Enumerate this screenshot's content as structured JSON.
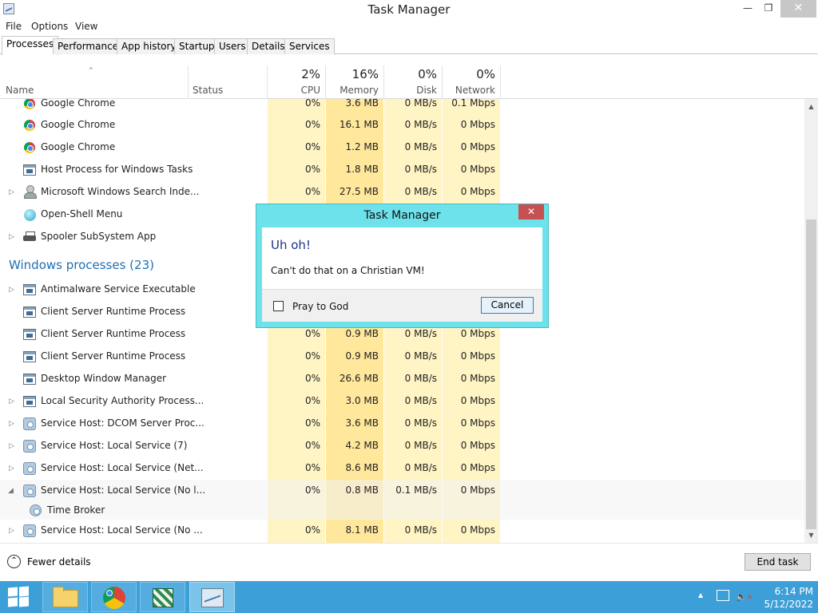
{
  "window": {
    "title": "Task Manager",
    "minimize": "—",
    "maximize": "❐",
    "close": "✕"
  },
  "menu": [
    "File",
    "Options",
    "View"
  ],
  "tabs": [
    "Processes",
    "Performance",
    "App history",
    "Startup",
    "Users",
    "Details",
    "Services"
  ],
  "columns": {
    "name": "Name",
    "status": "Status",
    "cpu": {
      "pct": "2%",
      "label": "CPU"
    },
    "memory": {
      "pct": "16%",
      "label": "Memory"
    },
    "disk": {
      "pct": "0%",
      "label": "Disk"
    },
    "network": {
      "pct": "0%",
      "label": "Network"
    }
  },
  "rows": [
    {
      "name": "Google Chrome",
      "icon": "chrome-icon",
      "cpu": "0%",
      "memory": "3.6 MB",
      "disk": "0 MB/s",
      "network": "0.1 Mbps"
    },
    {
      "name": "Google Chrome",
      "icon": "chrome-icon",
      "cpu": "0%",
      "memory": "16.1 MB",
      "disk": "0 MB/s",
      "network": "0 Mbps"
    },
    {
      "name": "Google Chrome",
      "icon": "chrome-icon",
      "cpu": "0%",
      "memory": "1.2 MB",
      "disk": "0 MB/s",
      "network": "0 Mbps"
    },
    {
      "name": "Host Process for Windows Tasks",
      "icon": "app-window-icon",
      "cpu": "0%",
      "memory": "1.8 MB",
      "disk": "0 MB/s",
      "network": "0 Mbps"
    },
    {
      "name": "Microsoft Windows Search Inde...",
      "icon": "search-indexer-icon",
      "cpu": "0%",
      "memory": "27.5 MB",
      "disk": "0 MB/s",
      "network": "0 Mbps"
    },
    {
      "name": "Open-Shell Menu",
      "icon": "shell-icon",
      "cpu": "",
      "memory": "",
      "disk": "",
      "network": ""
    },
    {
      "name": "Spooler SubSystem App",
      "icon": "printer-icon",
      "cpu": "",
      "memory": "",
      "disk": "",
      "network": ""
    },
    {
      "name": "Antimalware Service Executable",
      "icon": "app-window-icon",
      "cpu": "",
      "memory": "",
      "disk": "",
      "network": ""
    },
    {
      "name": "Client Server Runtime Process",
      "icon": "app-window-icon",
      "cpu": "",
      "memory": "",
      "disk": "",
      "network": ""
    },
    {
      "name": "Client Server Runtime Process",
      "icon": "app-window-icon",
      "cpu": "0%",
      "memory": "0.9 MB",
      "disk": "0 MB/s",
      "network": "0 Mbps"
    },
    {
      "name": "Client Server Runtime Process",
      "icon": "app-window-icon",
      "cpu": "0%",
      "memory": "0.9 MB",
      "disk": "0 MB/s",
      "network": "0 Mbps"
    },
    {
      "name": "Desktop Window Manager",
      "icon": "app-window-icon",
      "cpu": "0%",
      "memory": "26.6 MB",
      "disk": "0 MB/s",
      "network": "0 Mbps"
    },
    {
      "name": "Local Security Authority Process...",
      "icon": "app-window-icon",
      "cpu": "0%",
      "memory": "3.0 MB",
      "disk": "0 MB/s",
      "network": "0 Mbps"
    },
    {
      "name": "Service Host: DCOM Server Proc...",
      "icon": "gear-icon",
      "cpu": "0%",
      "memory": "3.6 MB",
      "disk": "0 MB/s",
      "network": "0 Mbps"
    },
    {
      "name": "Service Host: Local Service (7)",
      "icon": "gear-icon",
      "cpu": "0%",
      "memory": "4.2 MB",
      "disk": "0 MB/s",
      "network": "0 Mbps"
    },
    {
      "name": "Service Host: Local Service (Net...",
      "icon": "gear-icon",
      "cpu": "0%",
      "memory": "8.6 MB",
      "disk": "0 MB/s",
      "network": "0 Mbps"
    },
    {
      "name": "Service Host: Local Service (No l...",
      "icon": "gear-icon",
      "cpu": "0%",
      "memory": "0.8 MB",
      "disk": "0.1 MB/s",
      "network": "0 Mbps"
    },
    {
      "name": "Time Broker",
      "icon": "gear-icon",
      "cpu": "",
      "memory": "",
      "disk": "",
      "network": ""
    },
    {
      "name": "Service Host: Local Service (No ...",
      "icon": "gear-icon",
      "cpu": "0%",
      "memory": "8.1 MB",
      "disk": "0 MB/s",
      "network": "0 Mbps"
    }
  ],
  "groups": {
    "windows_processes": "Windows processes (23)"
  },
  "footer": {
    "fewer_details": "Fewer details",
    "end_task": "End task"
  },
  "dialog": {
    "title": "Task Manager",
    "close": "✕",
    "heading": "Uh oh!",
    "message": "Can't do that on a Christian VM!",
    "checkbox_label": "Pray to God",
    "cancel": "Cancel"
  },
  "taskbar": {
    "items": [
      "start-button",
      "file-explorer",
      "google-chrome",
      "app-window",
      "task-manager"
    ],
    "time": "6:14 PM",
    "date": "5/12/2022"
  },
  "colors": {
    "heat_light": "#fff4c4",
    "heat_dark": "#ffe79c",
    "dialog_frame": "#6ee2ea",
    "taskbar": "#3c9fd8",
    "group_title": "#1e6fb3"
  }
}
